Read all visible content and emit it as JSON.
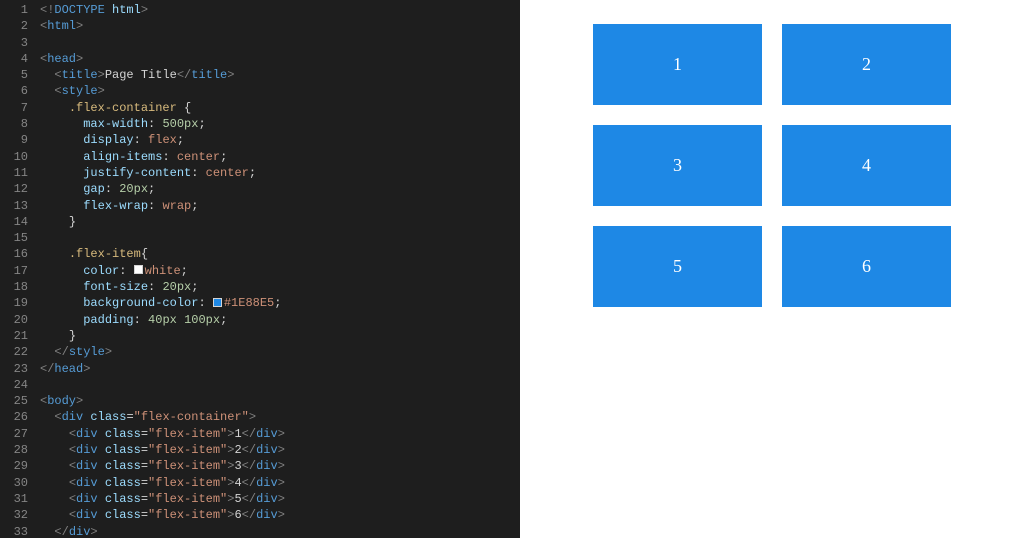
{
  "gutter": [
    "1",
    "2",
    "3",
    "4",
    "5",
    "6",
    "7",
    "8",
    "9",
    "10",
    "11",
    "12",
    "13",
    "14",
    "15",
    "16",
    "17",
    "18",
    "19",
    "20",
    "21",
    "22",
    "23",
    "24",
    "25",
    "26",
    "27",
    "28",
    "29",
    "30",
    "31",
    "32",
    "33"
  ],
  "code": {
    "doctype_open": "<!",
    "doctype_kw": "DOCTYPE",
    "doctype_val": "html",
    "doctype_close": ">",
    "tag_html": "html",
    "tag_head": "head",
    "tag_title": "title",
    "title_text": "Page Title",
    "tag_style": "style",
    "sel_flex_container": ".flex-container",
    "brace_open": "{",
    "brace_close": "}",
    "prop_max_width": "max-width",
    "val_500px": "500px",
    "prop_display": "display",
    "val_flex": "flex",
    "prop_align_items": "align-items",
    "val_center": "center",
    "prop_justify_content": "justify-content",
    "prop_gap": "gap",
    "val_20px": "20px",
    "prop_flex_wrap": "flex-wrap",
    "val_wrap": "wrap",
    "sel_flex_item": ".flex-item",
    "prop_color": "color",
    "val_white": "white",
    "prop_font_size": "font-size",
    "prop_bg_color": "background-color",
    "val_hex": "#1E88E5",
    "prop_padding": "padding",
    "val_40px": "40px",
    "val_100px": "100px",
    "tag_body": "body",
    "tag_div": "div",
    "attr_class": "class",
    "cls_flex_container": "flex-container",
    "cls_flex_item": "flex-item",
    "item1": "1",
    "item2": "2",
    "item3": "3",
    "item4": "4",
    "item5": "5",
    "item6": "6"
  },
  "preview": {
    "items": [
      "1",
      "2",
      "3",
      "4",
      "5",
      "6"
    ],
    "accent_color": "#1E88E5"
  }
}
